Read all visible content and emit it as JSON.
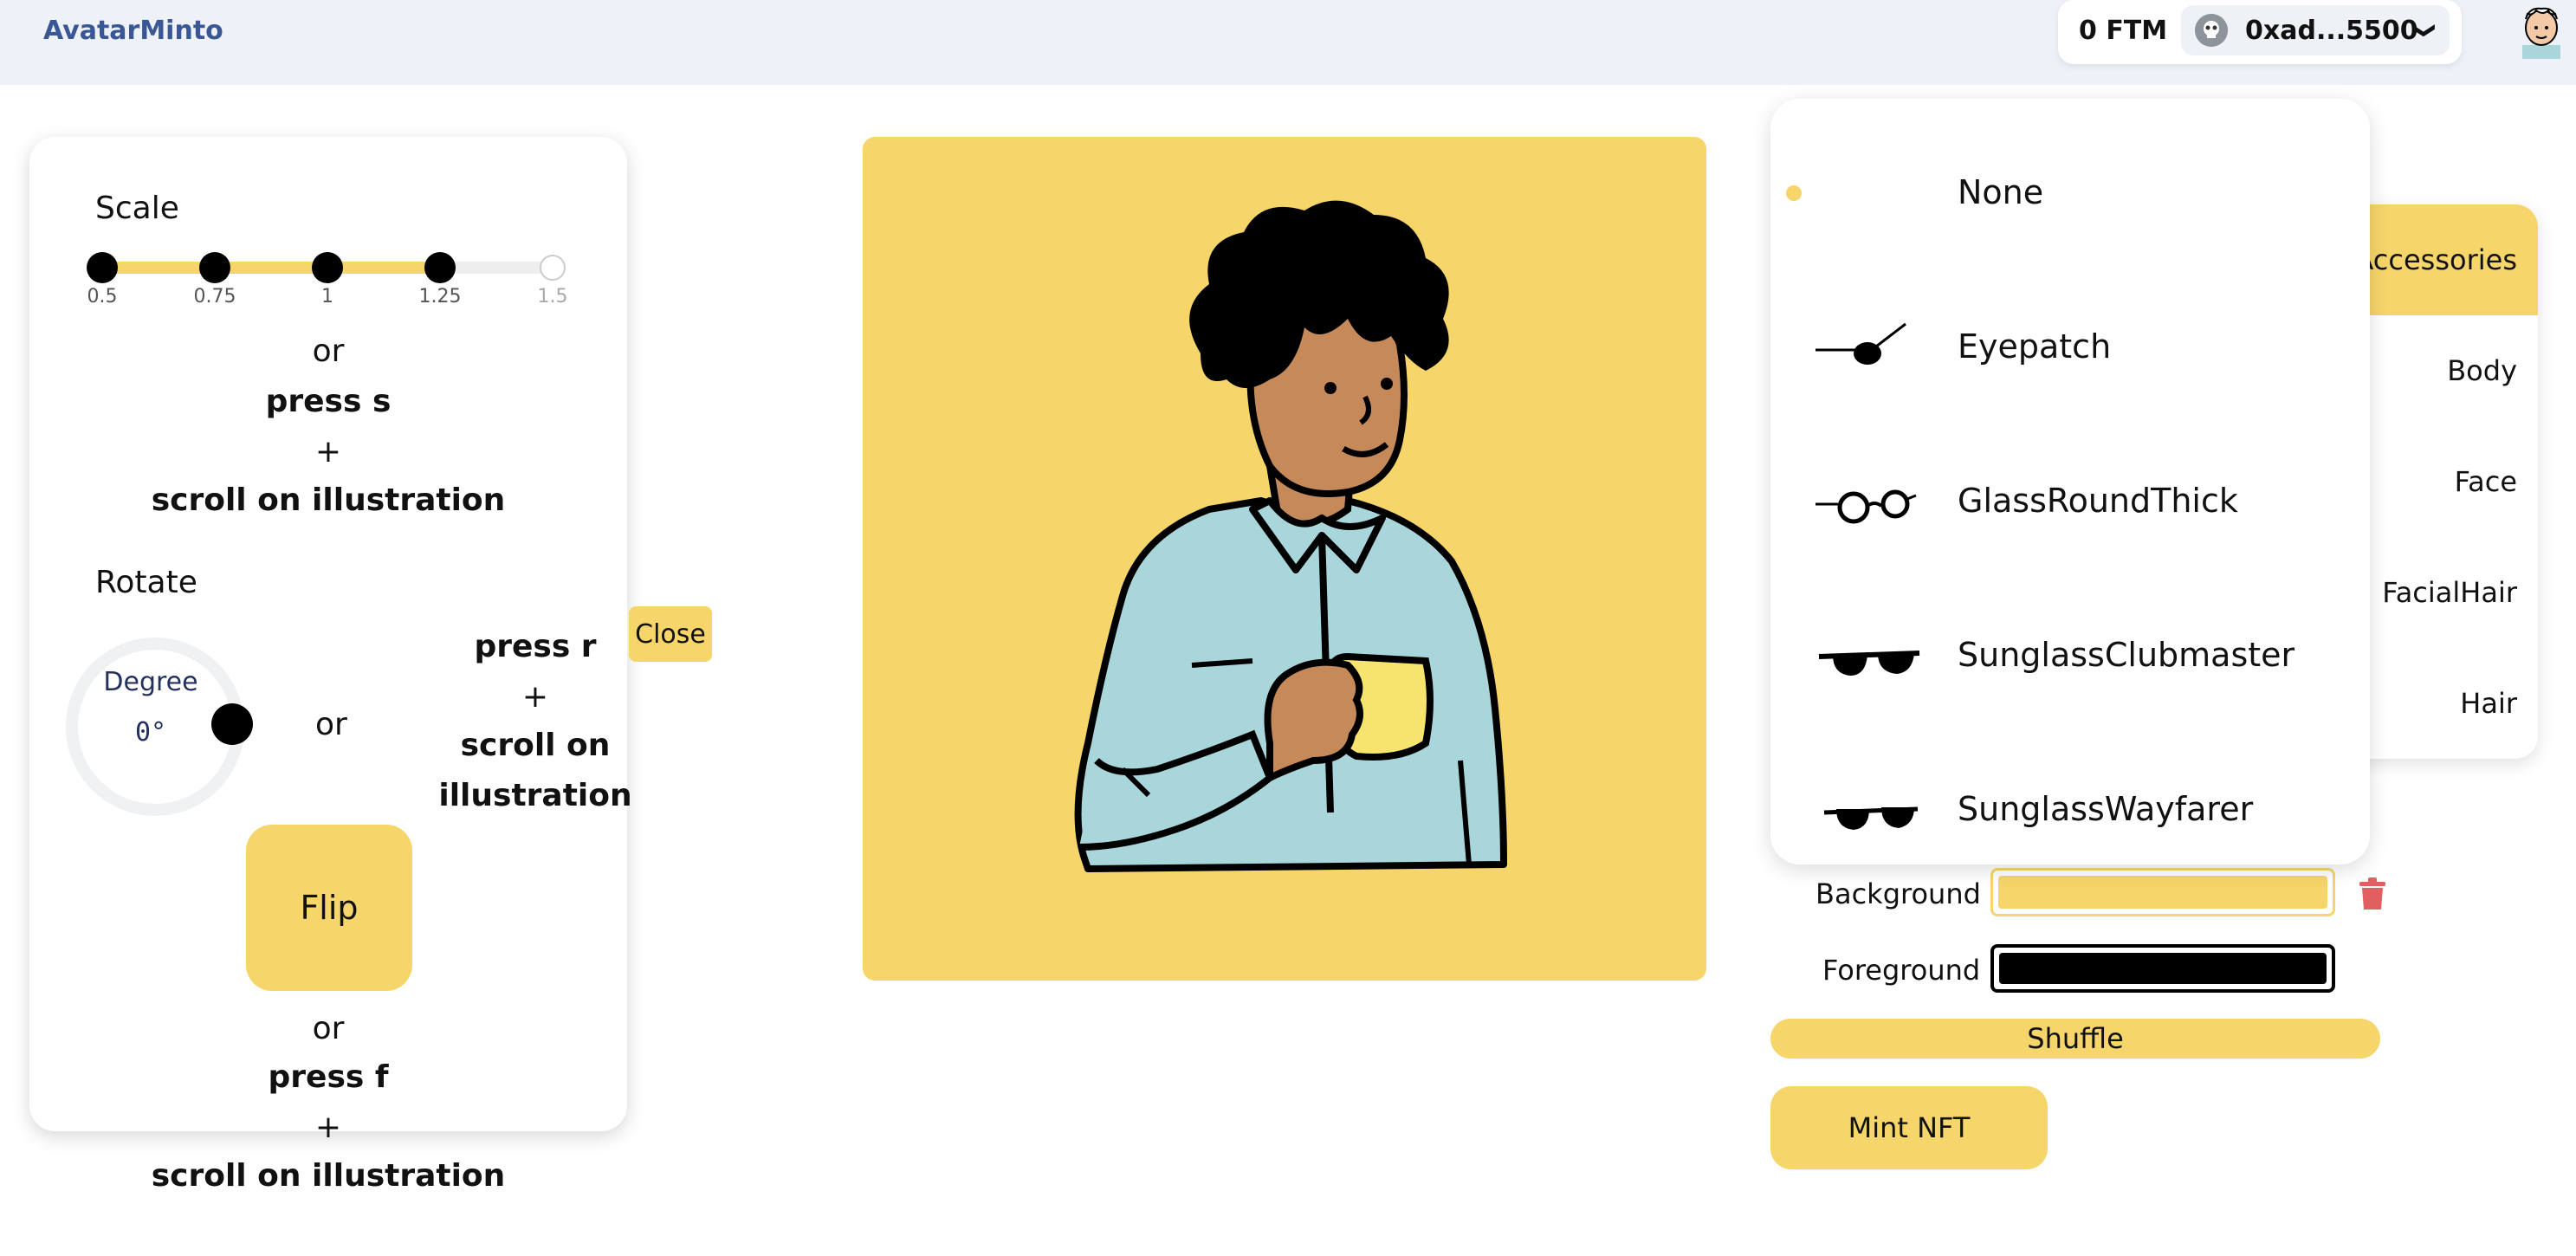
{
  "header": {
    "brand": "AvatarMinto",
    "balance": "0 FTM",
    "account": "0xad...5500",
    "chevron": "❯"
  },
  "transform": {
    "scale_label": "Scale",
    "scale_ticks": [
      "0.5",
      "0.75",
      "1",
      "1.25",
      "1.5"
    ],
    "scale_value": 1.25,
    "or": "or",
    "press_s": "press s",
    "plus": "+",
    "scroll": "scroll on illustration",
    "rotate_label": "Rotate",
    "degree_label": "Degree",
    "degree_value": "0°",
    "press_r": "press r",
    "scroll_line1": "scroll on",
    "scroll_line2": "illustration",
    "flip_label": "Flip",
    "press_f": "press f",
    "close_label": "Close"
  },
  "accessories": {
    "options": [
      {
        "label": "None",
        "icon": "none",
        "selected": true
      },
      {
        "label": "Eyepatch",
        "icon": "eyepatch-icon"
      },
      {
        "label": "GlassRoundThick",
        "icon": "round-glasses-icon"
      },
      {
        "label": "SunglassClubmaster",
        "icon": "sunglasses-icon"
      },
      {
        "label": "SunglassWayfarer",
        "icon": "sunglasses-icon"
      }
    ]
  },
  "categories": [
    "Accessories",
    "Body",
    "Face",
    "FacialHair",
    "Hair"
  ],
  "active_category": "Accessories",
  "colors": {
    "background_label": "Background",
    "background_value": "#f6d56b",
    "foreground_label": "Foreground",
    "foreground_value": "#000000"
  },
  "actions": {
    "shuffle": "Shuffle",
    "mint": "Mint NFT"
  },
  "theme": {
    "accent": "#f6d56b",
    "brand": "#3a5795",
    "skin": "#c68a5a",
    "shirt": "#a9d6db"
  }
}
